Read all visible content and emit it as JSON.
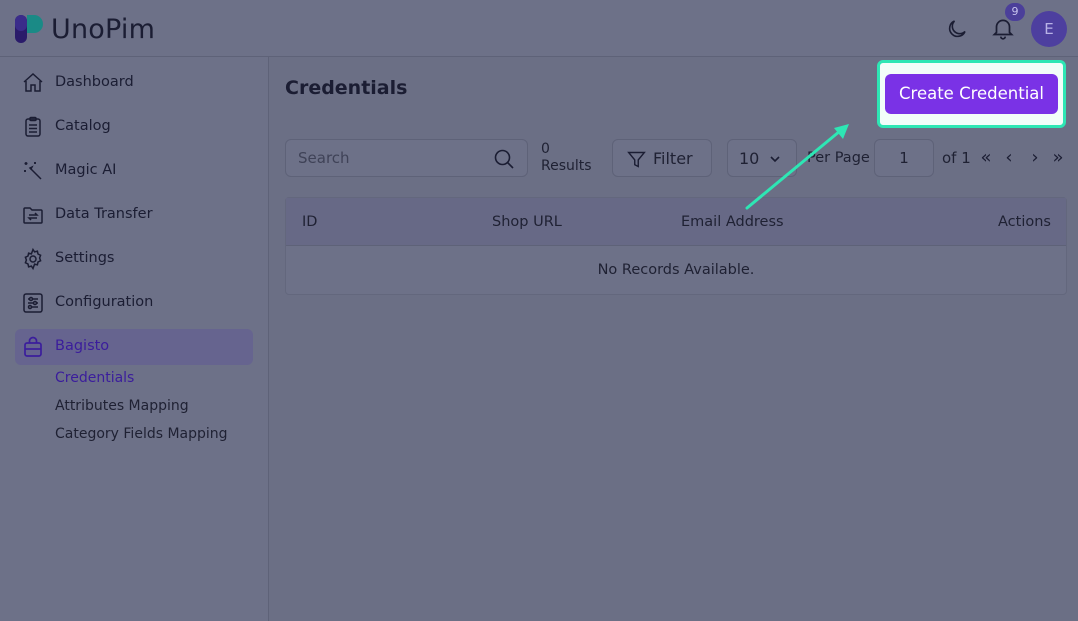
{
  "header": {
    "brand": "UnoPim",
    "notifications_count": "9",
    "avatar_initial": "E",
    "icons": [
      "moon-icon",
      "bell-icon"
    ]
  },
  "sidebar": {
    "items": [
      {
        "label": "Dashboard",
        "icon": "home-icon"
      },
      {
        "label": "Catalog",
        "icon": "clipboard-icon"
      },
      {
        "label": "Magic AI",
        "icon": "magic-wand-icon"
      },
      {
        "label": "Data Transfer",
        "icon": "folder-transfer-icon"
      },
      {
        "label": "Settings",
        "icon": "gear-icon"
      },
      {
        "label": "Configuration",
        "icon": "sliders-icon"
      },
      {
        "label": "Bagisto",
        "icon": "shopping-bag-icon",
        "active": true
      }
    ],
    "sub_items": [
      {
        "label": "Credentials",
        "active": true
      },
      {
        "label": "Attributes Mapping"
      },
      {
        "label": "Category Fields Mapping"
      }
    ]
  },
  "main": {
    "title": "Credentials",
    "create_button": "Create Credential",
    "search_placeholder": "Search",
    "results_count": "0",
    "results_label": "Results",
    "filter_label": "Filter",
    "per_page_value": "10",
    "per_page_label": "Per Page",
    "page_value": "1",
    "of_label": "of 1",
    "pagination": {
      "first": "«",
      "prev": "‹",
      "next": "›",
      "last": "»"
    },
    "table": {
      "columns": [
        "ID",
        "Shop URL",
        "Email Address",
        "Actions"
      ],
      "empty_message": "No Records Available."
    }
  },
  "colors": {
    "accent": "#7a32e6",
    "highlight": "#2ee6b4",
    "active_text": "#3b1d9c"
  }
}
